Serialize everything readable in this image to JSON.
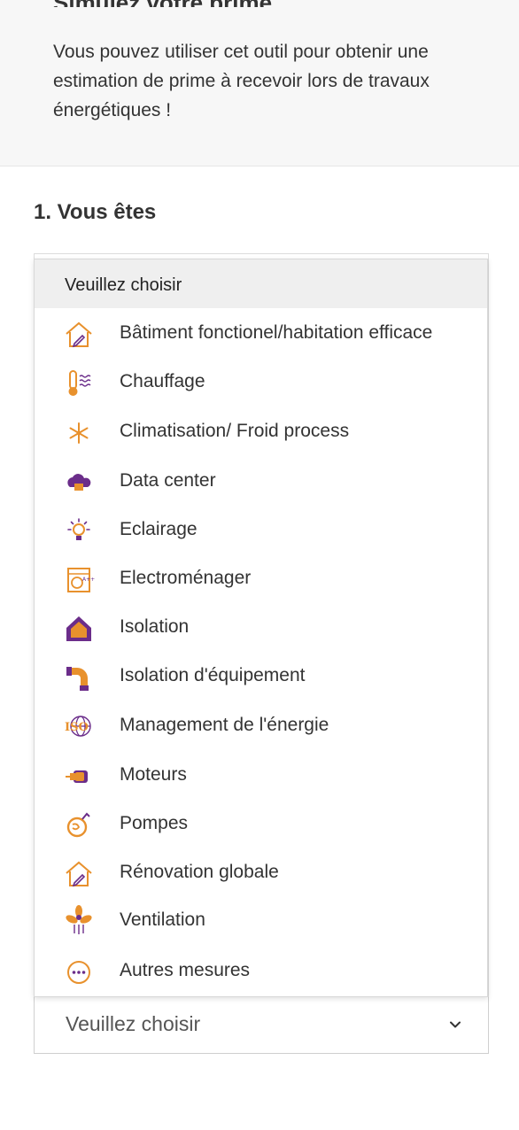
{
  "intro": {
    "heading": "Simulez votre prime",
    "text": "Vous pouvez utiliser cet outil pour obtenir une estimation de prime à recevoir lors de travaux énergétiques !"
  },
  "step": {
    "title": "1. Vous êtes"
  },
  "select": {
    "value": "Veuillez choisir"
  },
  "dropdown": {
    "header": "Veuillez choisir",
    "options": [
      {
        "label": "Bâtiment fonctionel/habitation efficace",
        "icon": "house-pencil-icon"
      },
      {
        "label": "Chauffage",
        "icon": "thermometer-heat-icon"
      },
      {
        "label": "Climatisation/ Froid process",
        "icon": "snowflake-icon"
      },
      {
        "label": "Data center",
        "icon": "cloud-server-icon"
      },
      {
        "label": "Eclairage",
        "icon": "lightbulb-icon"
      },
      {
        "label": "Electroménager",
        "icon": "appliance-icon"
      },
      {
        "label": "Isolation",
        "icon": "insulated-house-icon"
      },
      {
        "label": "Isolation d'équipement",
        "icon": "insulated-pipe-icon"
      },
      {
        "label": "Management de l'énergie",
        "icon": "iso-globe-icon"
      },
      {
        "label": "Moteurs",
        "icon": "motor-icon"
      },
      {
        "label": "Pompes",
        "icon": "pump-icon"
      },
      {
        "label": "Rénovation globale",
        "icon": "renovation-house-icon"
      },
      {
        "label": "Ventilation",
        "icon": "fan-icon"
      },
      {
        "label": "Autres mesures",
        "icon": "more-dots-icon"
      }
    ]
  },
  "colors": {
    "orange": "#e8912d",
    "purple": "#6b2d8a"
  }
}
